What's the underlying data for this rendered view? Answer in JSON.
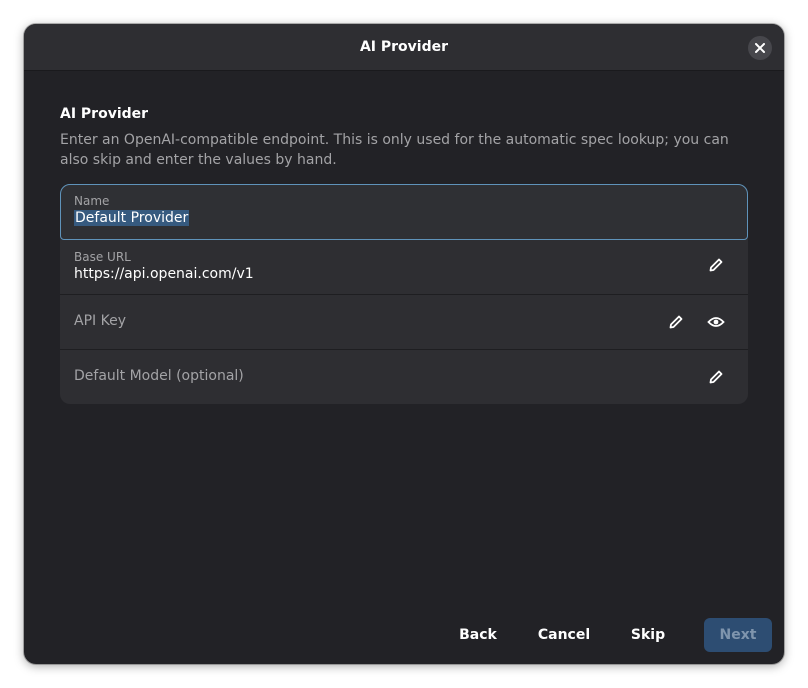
{
  "window": {
    "title": "AI Provider",
    "close_icon": "close-icon"
  },
  "section": {
    "title": "AI Provider",
    "description": "Enter an OpenAI-compatible endpoint. This is only used for the automatic spec lookup; you can also skip and enter the values by hand."
  },
  "fields": {
    "name": {
      "label": "Name",
      "value": "Default Provider",
      "selected": true
    },
    "base_url": {
      "label": "Base URL",
      "value": "https://api.openai.com/v1",
      "edit_icon": "pencil-icon"
    },
    "api_key": {
      "placeholder": "API Key",
      "edit_icon": "pencil-icon",
      "reveal_icon": "eye-icon"
    },
    "default_model": {
      "placeholder": "Default Model (optional)",
      "edit_icon": "pencil-icon"
    }
  },
  "footer": {
    "back_label": "Back",
    "cancel_label": "Cancel",
    "skip_label": "Skip",
    "next_label": "Next",
    "next_enabled": false
  },
  "colors": {
    "focus_ring": "#5f93ba",
    "selection": "#365a7f",
    "next_button_bg": "#2d4d72"
  }
}
